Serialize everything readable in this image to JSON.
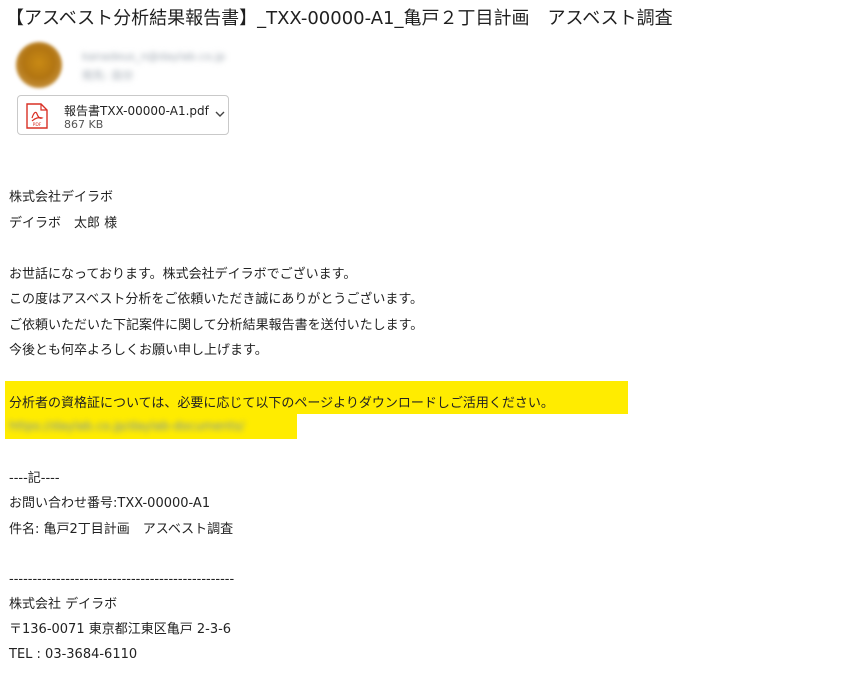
{
  "email": {
    "subject": "【アスベスト分析結果報告書】_TXX-00000-A1_亀戸２丁目計画　アスベスト調査",
    "sender": {
      "name": "kanadeus_n@daylab.co.jp",
      "to": "宛先:    自分"
    },
    "attachment": {
      "filename": "報告書TXX-00000-A1.pdf",
      "size": "867 KB",
      "icon": "pdf-icon"
    }
  },
  "body": {
    "addressee_company": "株式会社デイラボ",
    "addressee_name": "デイラボ　太郎 様",
    "greeting1": "お世話になっております。株式会社デイラボでございます。",
    "greeting2": "この度はアスベスト分析をご依頼いただき誠にありがとうございます。",
    "greeting3": "ご依頼いただいた下記案件に関して分析結果報告書を送付いたします。",
    "greeting4": "今後とも何卒よろしくお願い申し上げます。",
    "highlight_text": "分析者の資格証については、必要に応じて以下のページよりダウンロードしご活用ください。",
    "link_text": "https://daylab.co.jp/daylab-documents/",
    "record_header": "----記----",
    "inquiry_number": "お問い合わせ番号:TXX-00000-A1",
    "case_name": "件名: 亀戸2丁目計画　アスベスト調査",
    "divider": "------------------------------------------------",
    "sig_company": "株式会社 デイラボ",
    "sig_address": "〒136-0071 東京都江東区亀戸 2-3-6",
    "sig_tel": "TEL : 03-3684-6110"
  },
  "colors": {
    "highlight": "#ffec00",
    "pdf_red": "#d93025"
  }
}
